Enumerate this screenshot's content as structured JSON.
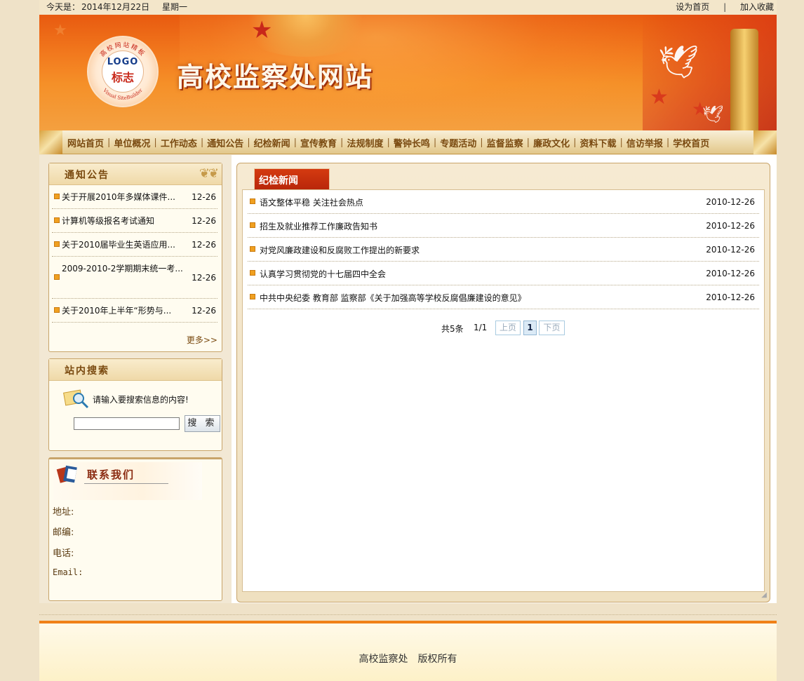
{
  "topbar": {
    "date_label": "今天是：",
    "date": "2014年12月22日",
    "weekday": "星期一",
    "set_home": "设为首页",
    "separator": "|",
    "add_favorite": "加入收藏"
  },
  "banner": {
    "site_title": "高校监察处网站",
    "logo_en": "LOGO",
    "logo_cn": "标志",
    "logo_ring_top": "高校网站精板",
    "logo_ring_bottom": "Visual SiteBuilder"
  },
  "nav": {
    "items": [
      "网站首页",
      "单位概况",
      "工作动态",
      "通知公告",
      "纪检新闻",
      "宣传教育",
      "法规制度",
      "警钟长鸣",
      "专题活动",
      "监督监察",
      "廉政文化",
      "资料下载",
      "信访举报",
      "学校首页"
    ],
    "separator": "|"
  },
  "notice": {
    "title": "通知公告",
    "items": [
      {
        "text": "关于开展2010年多媒体课件...",
        "date": "12-26"
      },
      {
        "text": "计算机等级报名考试通知",
        "date": "12-26"
      },
      {
        "text": "关于2010届毕业生英语应用...",
        "date": "12-26"
      },
      {
        "text": "2009-2010-2学期期末统一考...",
        "date": "12-26"
      },
      {
        "text": "关于2010年上半年“形势与...",
        "date": "12-26"
      }
    ],
    "more": "更多>>"
  },
  "search": {
    "title": "站内搜索",
    "hint": "请输入要搜索信息的内容!",
    "input_value": "",
    "button": "搜 索"
  },
  "contact": {
    "title": "联系我们",
    "address": "地址:",
    "postcode": "邮编:",
    "phone": "电话:",
    "email": "Email:"
  },
  "news": {
    "tab": "纪检新闻",
    "items": [
      {
        "text": "语文整体平稳 关注社会热点",
        "date": "2010-12-26"
      },
      {
        "text": "招生及就业推荐工作廉政告知书",
        "date": "2010-12-26"
      },
      {
        "text": "对党风廉政建设和反腐败工作提出的新要求",
        "date": "2010-12-26"
      },
      {
        "text": "认真学习贯彻党的十七届四中全会",
        "date": "2010-12-26"
      },
      {
        "text": "中共中央纪委 教育部 监察部《关于加强高等学校反腐倡廉建设的意见》",
        "date": "2010-12-26"
      }
    ],
    "pager": {
      "total": "共5条",
      "page_of": "1/1",
      "prev": "上页",
      "current": "1",
      "next": "下页"
    }
  },
  "footer": {
    "copyright": "高校监察处　版权所有"
  }
}
